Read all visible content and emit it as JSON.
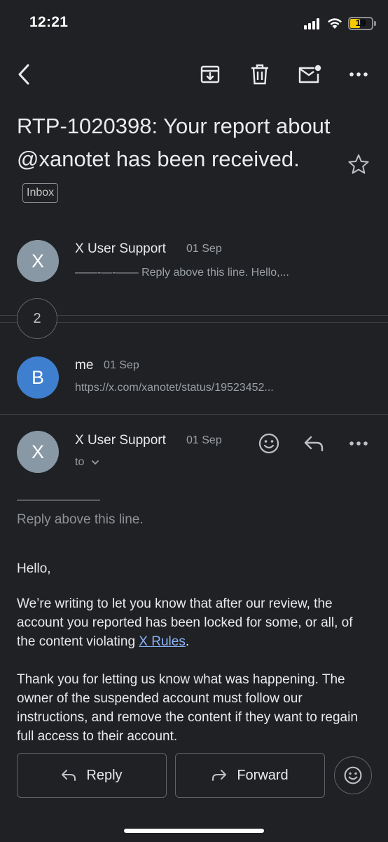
{
  "status_bar": {
    "time": "12:21",
    "battery": "19"
  },
  "toolbar": {
    "icons": [
      "back-arrow-icon",
      "archive-icon",
      "delete-icon",
      "mark-unread-icon",
      "more-icon"
    ]
  },
  "subject": {
    "text": "RTP-1020398: Your report about @xanotet has been received.",
    "label_chip": "Inbox"
  },
  "messages": [
    {
      "avatar_letter": "X",
      "sender": "X User Support",
      "date": "01 Sep",
      "snippet": "——-—-—— Reply above this line. Hello,..."
    },
    {
      "avatar_letter": "B",
      "sender": "me",
      "date": "01 Sep",
      "snippet": "https://x.com/xanotet/status/19523452..."
    }
  ],
  "collapsed_count": "2",
  "open_message": {
    "avatar_letter": "X",
    "sender": "X User Support",
    "date": "01 Sep",
    "recipient_label": "to",
    "separator": "———————",
    "reply_line": "Reply above this line.",
    "greeting": "Hello,",
    "paragraph1_before_link": "We’re writing to let you know that after our review, the account you reported has been locked for some, or all, of the content violating ",
    "paragraph1_link": "X Rules",
    "paragraph1_after_link": ".",
    "paragraph2": "Thank you for letting us know what was happening. The owner of the suspended account must follow our instructions, and remove the content if they want to regain full access to their account."
  },
  "actions": {
    "reply_label": "Reply",
    "forward_label": "Forward"
  },
  "colors": {
    "background": "#202124",
    "link": "#8ab4f8",
    "avatar_gray": "#8898a4",
    "avatar_blue": "#3f7fd0",
    "battery": "#f5c800"
  }
}
